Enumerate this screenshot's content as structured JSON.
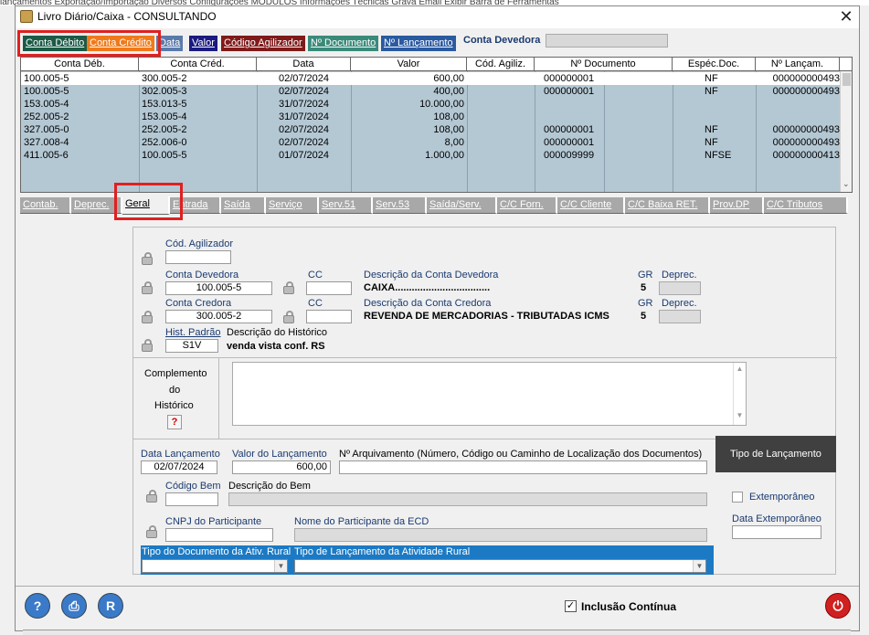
{
  "top_strip": "lançamentos   Exportação/Importação   Diversos   Configurações   MÓDULOS   Informações Técnicas   Grava Email   Exibir Barra de Ferramentas",
  "window": {
    "title": "Livro Diário/Caixa   -   CONSULTANDO",
    "close": "✕"
  },
  "top_tabs": [
    {
      "label": "Conta Débito",
      "bg": "#1a5a46"
    },
    {
      "label": "Conta Crédito",
      "bg": "#f07a1a"
    },
    {
      "label": "Data",
      "bg": "#5a7aaa"
    },
    {
      "label": "Valor",
      "bg": "#1a1a80"
    },
    {
      "label": "Código Agilizador",
      "bg": "#801a1a"
    },
    {
      "label": "Nº Documento",
      "bg": "#3a8a7a"
    },
    {
      "label": "Nº Lançamento",
      "bg": "#2a5aa0"
    }
  ],
  "conta_devedora_label": "Conta Devedora",
  "grid": {
    "headers": [
      "Conta Déb.",
      "Conta Créd.",
      "Data",
      "Valor",
      "Cód. Agiliz.",
      "Nº Documento",
      "Espéc.Doc.",
      "Nº Lançam."
    ],
    "rows": [
      [
        "100.005-5",
        "300.005-2",
        "02/07/2024",
        "600,00",
        "",
        "000000001",
        "NF",
        "000000000493"
      ],
      [
        "100.005-5",
        "302.005-3",
        "02/07/2024",
        "400,00",
        "",
        "000000001",
        "NF",
        "000000000493"
      ],
      [
        "153.005-4",
        "153.013-5",
        "31/07/2024",
        "10.000,00",
        "",
        "",
        "",
        ""
      ],
      [
        "252.005-2",
        "153.005-4",
        "31/07/2024",
        "108,00",
        "",
        "",
        "",
        ""
      ],
      [
        "327.005-0",
        "252.005-2",
        "02/07/2024",
        "108,00",
        "",
        "000000001",
        "NF",
        "000000000493"
      ],
      [
        "327.008-4",
        "252.006-0",
        "02/07/2024",
        "8,00",
        "",
        "000000001",
        "NF",
        "000000000493"
      ],
      [
        "411.005-6",
        "100.005-5",
        "01/07/2024",
        "1.000,00",
        "",
        "000009999",
        "NFSE",
        "000000000413"
      ]
    ]
  },
  "second_tabs": [
    "Contab.",
    "Deprec.",
    "Geral",
    "Entrada",
    "Saída",
    "Serviço",
    "Serv.51",
    "Serv.53",
    "Saída/Serv.",
    "C/C Forn.",
    "C/C Cliente",
    "C/C Baixa RET.",
    "Prov.DP",
    "C/C Tributos"
  ],
  "form": {
    "cod_agilizador_label": "Cód. Agilizador",
    "conta_devedora_label": "Conta Devedora",
    "conta_devedora_value": "100.005-5",
    "cc_label": "CC",
    "desc_conta_devedora_label": "Descrição da Conta Devedora",
    "desc_conta_devedora_value": "CAIXA..................................",
    "gr_label": "GR",
    "deprec_label": "Deprec.",
    "gr_devedora": "5",
    "conta_credora_label": "Conta Credora",
    "conta_credora_value": "300.005-2",
    "desc_conta_credora_label": "Descrição da Conta Credora",
    "desc_conta_credora_value": "REVENDA DE MERCADORIAS - TRIBUTADAS ICMS",
    "gr_credora": "5",
    "hist_padrao_label": "Hist. Padrão",
    "hist_padrao_value": "S1V",
    "desc_historico_label": "Descrição do Histórico",
    "desc_historico_value": "venda vista conf. RS",
    "complemento_l1": "Complemento",
    "complemento_l2": "do",
    "complemento_l3": "Histórico",
    "help_btn": "?",
    "data_lancamento_label": "Data Lançamento",
    "data_lancamento_value": "02/07/2024",
    "valor_lancamento_label": "Valor do Lançamento",
    "valor_lancamento_value": "600,00",
    "arquivamento_label": "Nº Arquivamento (Número, Código ou Caminho de Localização dos Documentos)",
    "tipo_lancamento_title": "Tipo de Lançamento",
    "codigo_bem_label": "Código Bem",
    "descricao_bem_label": "Descrição do Bem",
    "extemporaneo_label": "Extemporâneo",
    "data_extemporaneo_label": "Data Extemporâneo",
    "cnpj_participante_label": "CNPJ do Participante",
    "nome_participante_label": "Nome do Participante da ECD",
    "tipo_doc_rural_label": "Tipo do Documento da Ativ. Rural",
    "tipo_lanc_rural_label": "Tipo de Lançamento da Atividade Rural"
  },
  "bottom": {
    "inclusao_label": "Inclusão Contínua",
    "inclusao_checked": "✓",
    "help": "?",
    "print": "⎙",
    "report": "R",
    "power": "⏻"
  }
}
